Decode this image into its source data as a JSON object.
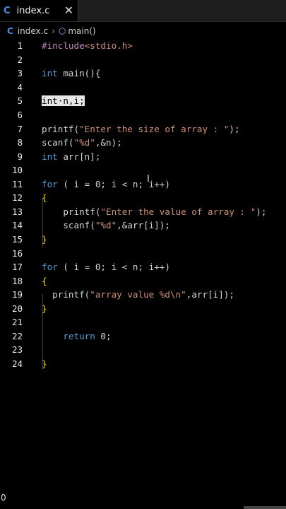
{
  "tab": {
    "icon": "C",
    "filename": "index.c",
    "close": "✕"
  },
  "breadcrumb": {
    "file_icon": "C",
    "file": "index.c",
    "symbol": "main()"
  },
  "lines": [
    {
      "n": "1",
      "text": "#include<stdio.h>"
    },
    {
      "n": "2",
      "text": ""
    },
    {
      "n": "3",
      "text": "int main(){"
    },
    {
      "n": "4",
      "text": ""
    },
    {
      "n": "5",
      "text": "int·n,i;"
    },
    {
      "n": "6",
      "text": ""
    },
    {
      "n": "7",
      "text": "printf(\"Enter the size of array : \");"
    },
    {
      "n": "8",
      "text": "scanf(\"%d\",&n);"
    },
    {
      "n": "9",
      "text": "int arr[n];"
    },
    {
      "n": "10",
      "text": ""
    },
    {
      "n": "11",
      "text": "for ( i = 0; i < n; i++)"
    },
    {
      "n": "12",
      "text": "{"
    },
    {
      "n": "13",
      "text": "    printf(\"Enter the value of array : \");"
    },
    {
      "n": "14",
      "text": "    scanf(\"%d\",&arr[i]);"
    },
    {
      "n": "15",
      "text": "}"
    },
    {
      "n": "16",
      "text": ""
    },
    {
      "n": "17",
      "text": "for ( i = 0; i < n; i++)"
    },
    {
      "n": "18",
      "text": "{"
    },
    {
      "n": "19",
      "text": "  printf(\"array value %d\\n\",arr[i]);"
    },
    {
      "n": "20",
      "text": "}"
    },
    {
      "n": "21",
      "text": ""
    },
    {
      "n": "22",
      "text": "    return 0;"
    },
    {
      "n": "23",
      "text": ""
    },
    {
      "n": "24",
      "text": "}"
    }
  ],
  "status": {
    "count": "0"
  },
  "colors": {
    "keyword": "#569cd6",
    "string": "#ce9178",
    "preprocessor": "#c586c0",
    "bracket": "#ffd700",
    "c_icon": "#4c8ee8"
  }
}
